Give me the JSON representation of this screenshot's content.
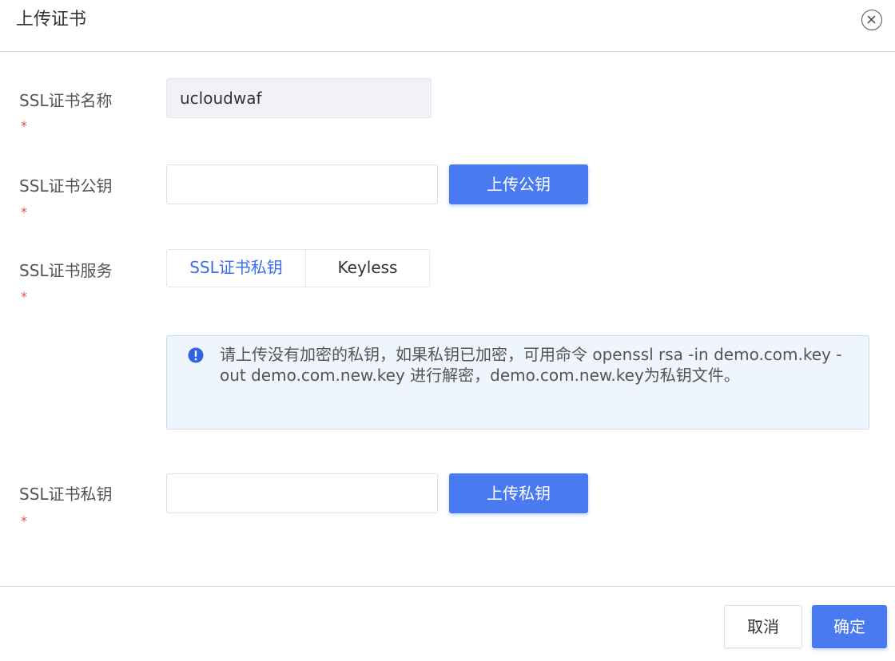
{
  "dialog": {
    "title": "上传证书",
    "close_icon": "close-circle-icon"
  },
  "form": {
    "name_field": {
      "label": "SSL证书名称",
      "required_mark": "*",
      "value": "ucloudwaf"
    },
    "public_key_field": {
      "label": "SSL证书公钥",
      "required_mark": "*",
      "value": "",
      "upload_button": "上传公钥"
    },
    "service_field": {
      "label": "SSL证书服务",
      "required_mark": "*",
      "options": [
        "SSL证书私钥",
        "Keyless"
      ],
      "selected": "SSL证书私钥"
    },
    "notice": {
      "icon": "info-circle-icon",
      "text": "请上传没有加密的私钥，如果私钥已加密，可用命令 openssl rsa -in demo.com.key -out demo.com.new.key 进行解密，demo.com.new.key为私钥文件。"
    },
    "private_key_field": {
      "label": "SSL证书私钥",
      "required_mark": "*",
      "value": "",
      "upload_button": "上传私钥"
    }
  },
  "footer": {
    "cancel_label": "取消",
    "confirm_label": "确定"
  },
  "colors": {
    "primary": "#4a7af0",
    "active_tab_text": "#3a6ef2",
    "required_star": "#e84a4a",
    "notice_background": "#eef5fd",
    "notice_border": "#c5dcf7",
    "notice_icon": "#2f63e0"
  }
}
